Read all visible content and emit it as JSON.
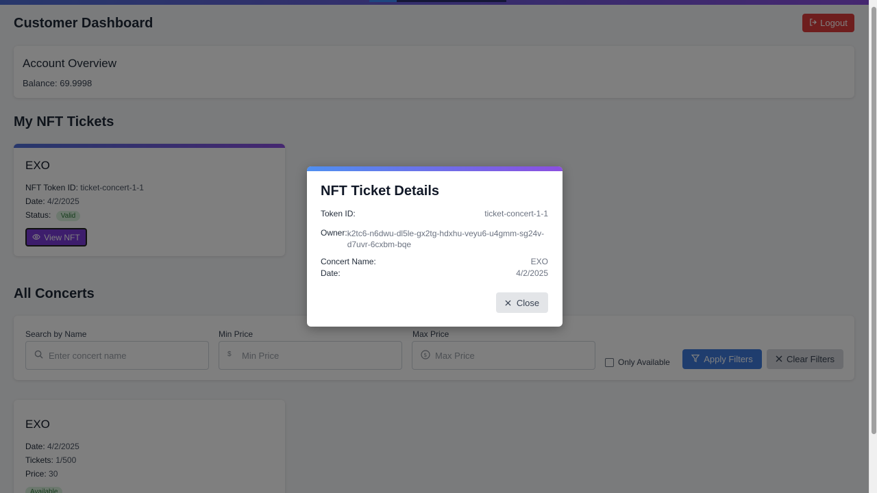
{
  "header": {
    "title": "Customer Dashboard",
    "logout_label": "Logout"
  },
  "account": {
    "title": "Account Overview",
    "balance_label": "Balance:",
    "balance_value": "69.9998"
  },
  "my_tickets": {
    "section_title": "My NFT Tickets",
    "ticket": {
      "name": "EXO",
      "token_label": "NFT Token ID:",
      "token_value": "ticket-concert-1-1",
      "date_label": "Date:",
      "date_value": "4/2/2025",
      "status_label": "Status:",
      "status_value": "Valid",
      "view_label": "View NFT"
    }
  },
  "all_concerts": {
    "section_title": "All Concerts",
    "filters": {
      "name_label": "Search by Name",
      "name_placeholder": "Enter concert name",
      "min_label": "Min Price",
      "min_placeholder": "Min Price",
      "max_label": "Max Price",
      "max_placeholder": "Max Price",
      "only_available_label": "Only Available",
      "apply_label": "Apply Filters",
      "clear_label": "Clear Filters"
    },
    "concert": {
      "name": "EXO",
      "date_label": "Date:",
      "date_value": "4/2/2025",
      "tickets_label": "Tickets:",
      "tickets_value": "1/500",
      "price_label": "Price:",
      "price_value": "30",
      "availability": "Available"
    }
  },
  "modal": {
    "title": "NFT Ticket Details",
    "token_label": "Token ID:",
    "token_value": "ticket-concert-1-1",
    "owner_label": "Owner:",
    "owner_value": "k2tc6-n6dwu-dl5le-gx2tg-hdxhu-veyu6-u4gmm-sg24v-d7uvr-6cxbm-bqe",
    "concert_label": "Concert Name:",
    "concert_value": "EXO",
    "date_label": "Date:",
    "date_value": "4/2/2025",
    "close_label": "Close"
  },
  "icons": {
    "logout": "logout-icon",
    "eye": "eye-icon",
    "search": "search-icon",
    "dollar": "dollar-icon",
    "filter": "filter-icon",
    "close": "close-icon"
  },
  "colors": {
    "accent_gradient_start": "#4f6fd6",
    "accent_gradient_end": "#8b4fe0",
    "logout": "#dc3c3c",
    "apply": "#3f7bdc",
    "view_nft": "#7b3ad8",
    "badge_green_bg": "#d8f0dc"
  }
}
